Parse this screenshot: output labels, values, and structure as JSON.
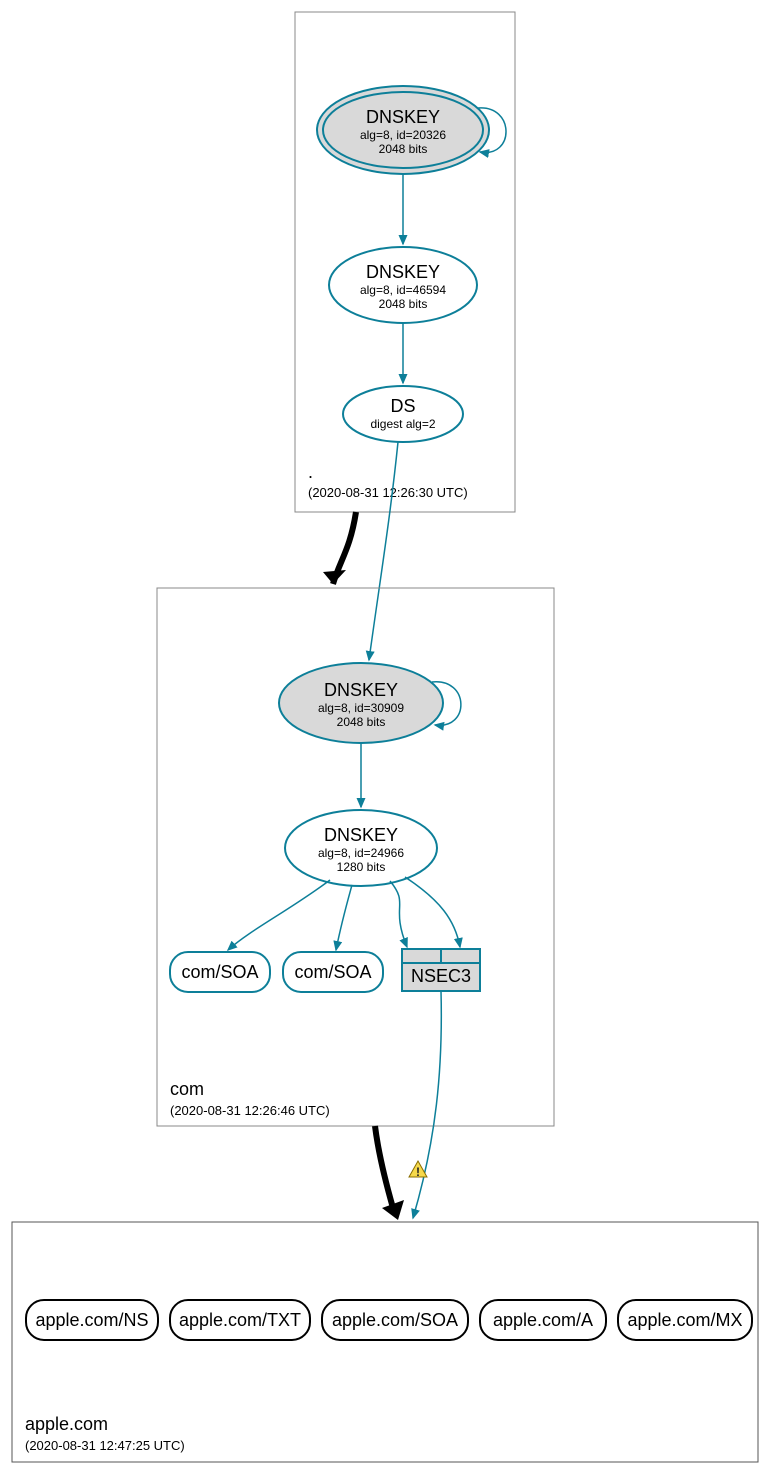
{
  "zones": {
    "root": {
      "name": ".",
      "timestamp": "(2020-08-31 12:26:30 UTC)",
      "dnskey_ksk": {
        "title": "DNSKEY",
        "line1": "alg=8, id=20326",
        "line2": "2048 bits"
      },
      "dnskey_zsk": {
        "title": "DNSKEY",
        "line1": "alg=8, id=46594",
        "line2": "2048 bits"
      },
      "ds": {
        "title": "DS",
        "line1": "digest alg=2"
      }
    },
    "com": {
      "name": "com",
      "timestamp": "(2020-08-31 12:26:46 UTC)",
      "dnskey_ksk": {
        "title": "DNSKEY",
        "line1": "alg=8, id=30909",
        "line2": "2048 bits"
      },
      "dnskey_zsk": {
        "title": "DNSKEY",
        "line1": "alg=8, id=24966",
        "line2": "1280 bits"
      },
      "soa1": "com/SOA",
      "soa2": "com/SOA",
      "nsec3": "NSEC3"
    },
    "apple": {
      "name": "apple.com",
      "timestamp": "(2020-08-31 12:47:25 UTC)",
      "records": {
        "ns": "apple.com/NS",
        "txt": "apple.com/TXT",
        "soa": "apple.com/SOA",
        "a": "apple.com/A",
        "mx": "apple.com/MX"
      }
    }
  }
}
